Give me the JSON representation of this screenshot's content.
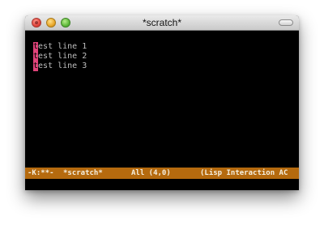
{
  "window": {
    "title": "*scratch*"
  },
  "editor": {
    "lines": [
      {
        "cursor_char": "t",
        "rest": "est line 1"
      },
      {
        "cursor_char": "t",
        "rest": "est line 2"
      },
      {
        "cursor_char": "t",
        "rest": "est line 3"
      }
    ]
  },
  "modeline": {
    "flags": "-K:**-",
    "buffer": "*scratch*",
    "position": "All (4,0)",
    "mode": "(Lisp Interaction AC"
  },
  "colors": {
    "background": "#000000",
    "text": "#bdbdbd",
    "cursor": "#e0447a",
    "modeline": "#b56a0e"
  }
}
